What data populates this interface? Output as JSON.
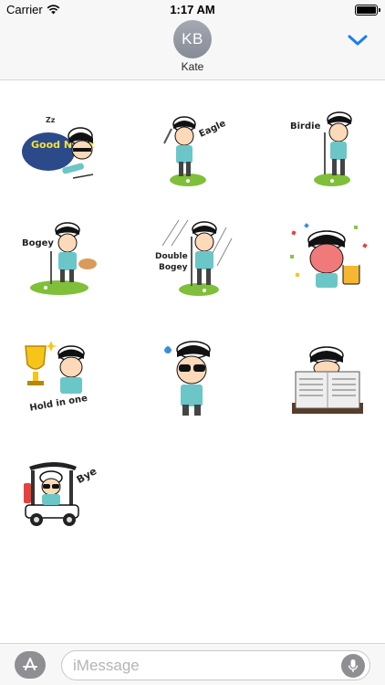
{
  "status_bar": {
    "carrier": "Carrier",
    "time": "1:17 AM",
    "battery_level": 1.0
  },
  "header": {
    "avatar_initials": "KB",
    "contact_name": "Kate",
    "collapse_icon": "chevron-down-icon",
    "accent_color": "#1a7cf5"
  },
  "stickers": [
    {
      "name": "good-night",
      "caption": "Good Night",
      "sleep_text": "Zz"
    },
    {
      "name": "eagle",
      "caption": "Eagle"
    },
    {
      "name": "birdie",
      "caption": "Birdie"
    },
    {
      "name": "bogey",
      "caption": "Bogey"
    },
    {
      "name": "double-bogey",
      "caption_line1": "Double",
      "caption_line2": "Bogey"
    },
    {
      "name": "cheers-beer"
    },
    {
      "name": "hole-in-one",
      "caption": "Hold in one"
    },
    {
      "name": "sweating-sunglasses"
    },
    {
      "name": "reading-newspaper"
    },
    {
      "name": "bye-golf-cart",
      "caption": "Bye"
    }
  ],
  "input_bar": {
    "placeholder": "iMessage",
    "app_store_icon": "app-store-icon",
    "mic_icon": "microphone-icon"
  }
}
